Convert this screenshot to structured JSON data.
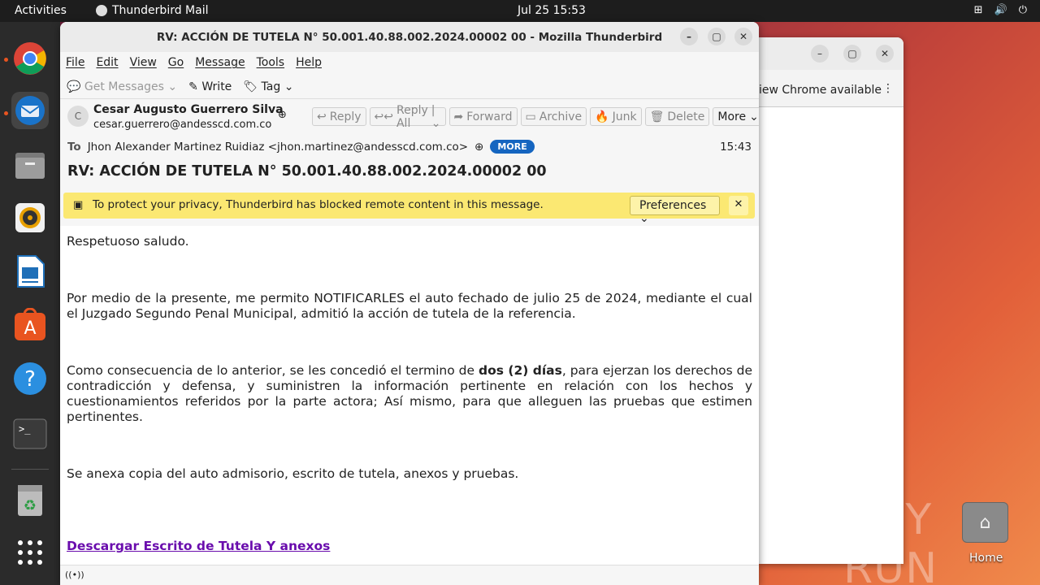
{
  "topbar": {
    "activities": "Activities",
    "app": "Thunderbird Mail",
    "clock": "Jul 25  15:53"
  },
  "tb": {
    "title": "RV: ACCIÓN DE TUTELA N° 50.001.40.88.002.2024.00002 00 - Mozilla Thunderbird",
    "menu": [
      "File",
      "Edit",
      "View",
      "Go",
      "Message",
      "Tools",
      "Help"
    ],
    "toolbar": {
      "get_messages": "Get Messages",
      "write": "Write",
      "tag": "Tag"
    },
    "header": {
      "avatar_initial": "C",
      "from_name": "Cesar Augusto Guerrero Silva",
      "from_email": "cesar.guerrero@andesscd.com.co",
      "to_label": "To",
      "to_value": "Jhon Alexander Martinez Ruidiaz <jhon.martinez@andesscd.com.co>",
      "more_badge": "MORE",
      "time": "15:43",
      "subject": "RV: ACCIÓN DE TUTELA N° 50.001.40.88.002.2024.00002 00"
    },
    "actions": {
      "reply": "Reply",
      "reply_all": "Reply All",
      "forward": "Forward",
      "archive": "Archive",
      "junk": "Junk",
      "delete": "Delete",
      "more": "More"
    },
    "notification": {
      "message": "To protect your privacy, Thunderbird has blocked remote content in this message.",
      "preferences": "Preferences"
    },
    "body": {
      "p1": "Respetuoso saludo.",
      "p2": "Por medio de la presente, me permito NOTIFICARLES el auto fechado de julio 25 de 2024, mediante el cual el Juzgado Segundo Penal Municipal, admitió la acción de tutela de la referencia.",
      "p3_pre": "Como consecuencia de lo anterior, se les concedió el termino de ",
      "p3_bold": "dos (2) días",
      "p3_post": ", para ejerzan los derechos de contradicción y defensa, y suministren la información pertinente en relación con los hechos y cuestionamientos referidos por la parte actora; Así mismo, para que alleguen las pruebas que estimen pertinentes.",
      "p4": "Se anexa copia del auto admisorio, escrito de tutela, anexos y pruebas.",
      "link": "Descargar Escrito de Tutela Y anexos"
    }
  },
  "chrome_bg": {
    "bar_text": "iew Chrome available"
  },
  "desktop": {
    "home_label": "Home",
    "watermark": "ANY RUN"
  }
}
